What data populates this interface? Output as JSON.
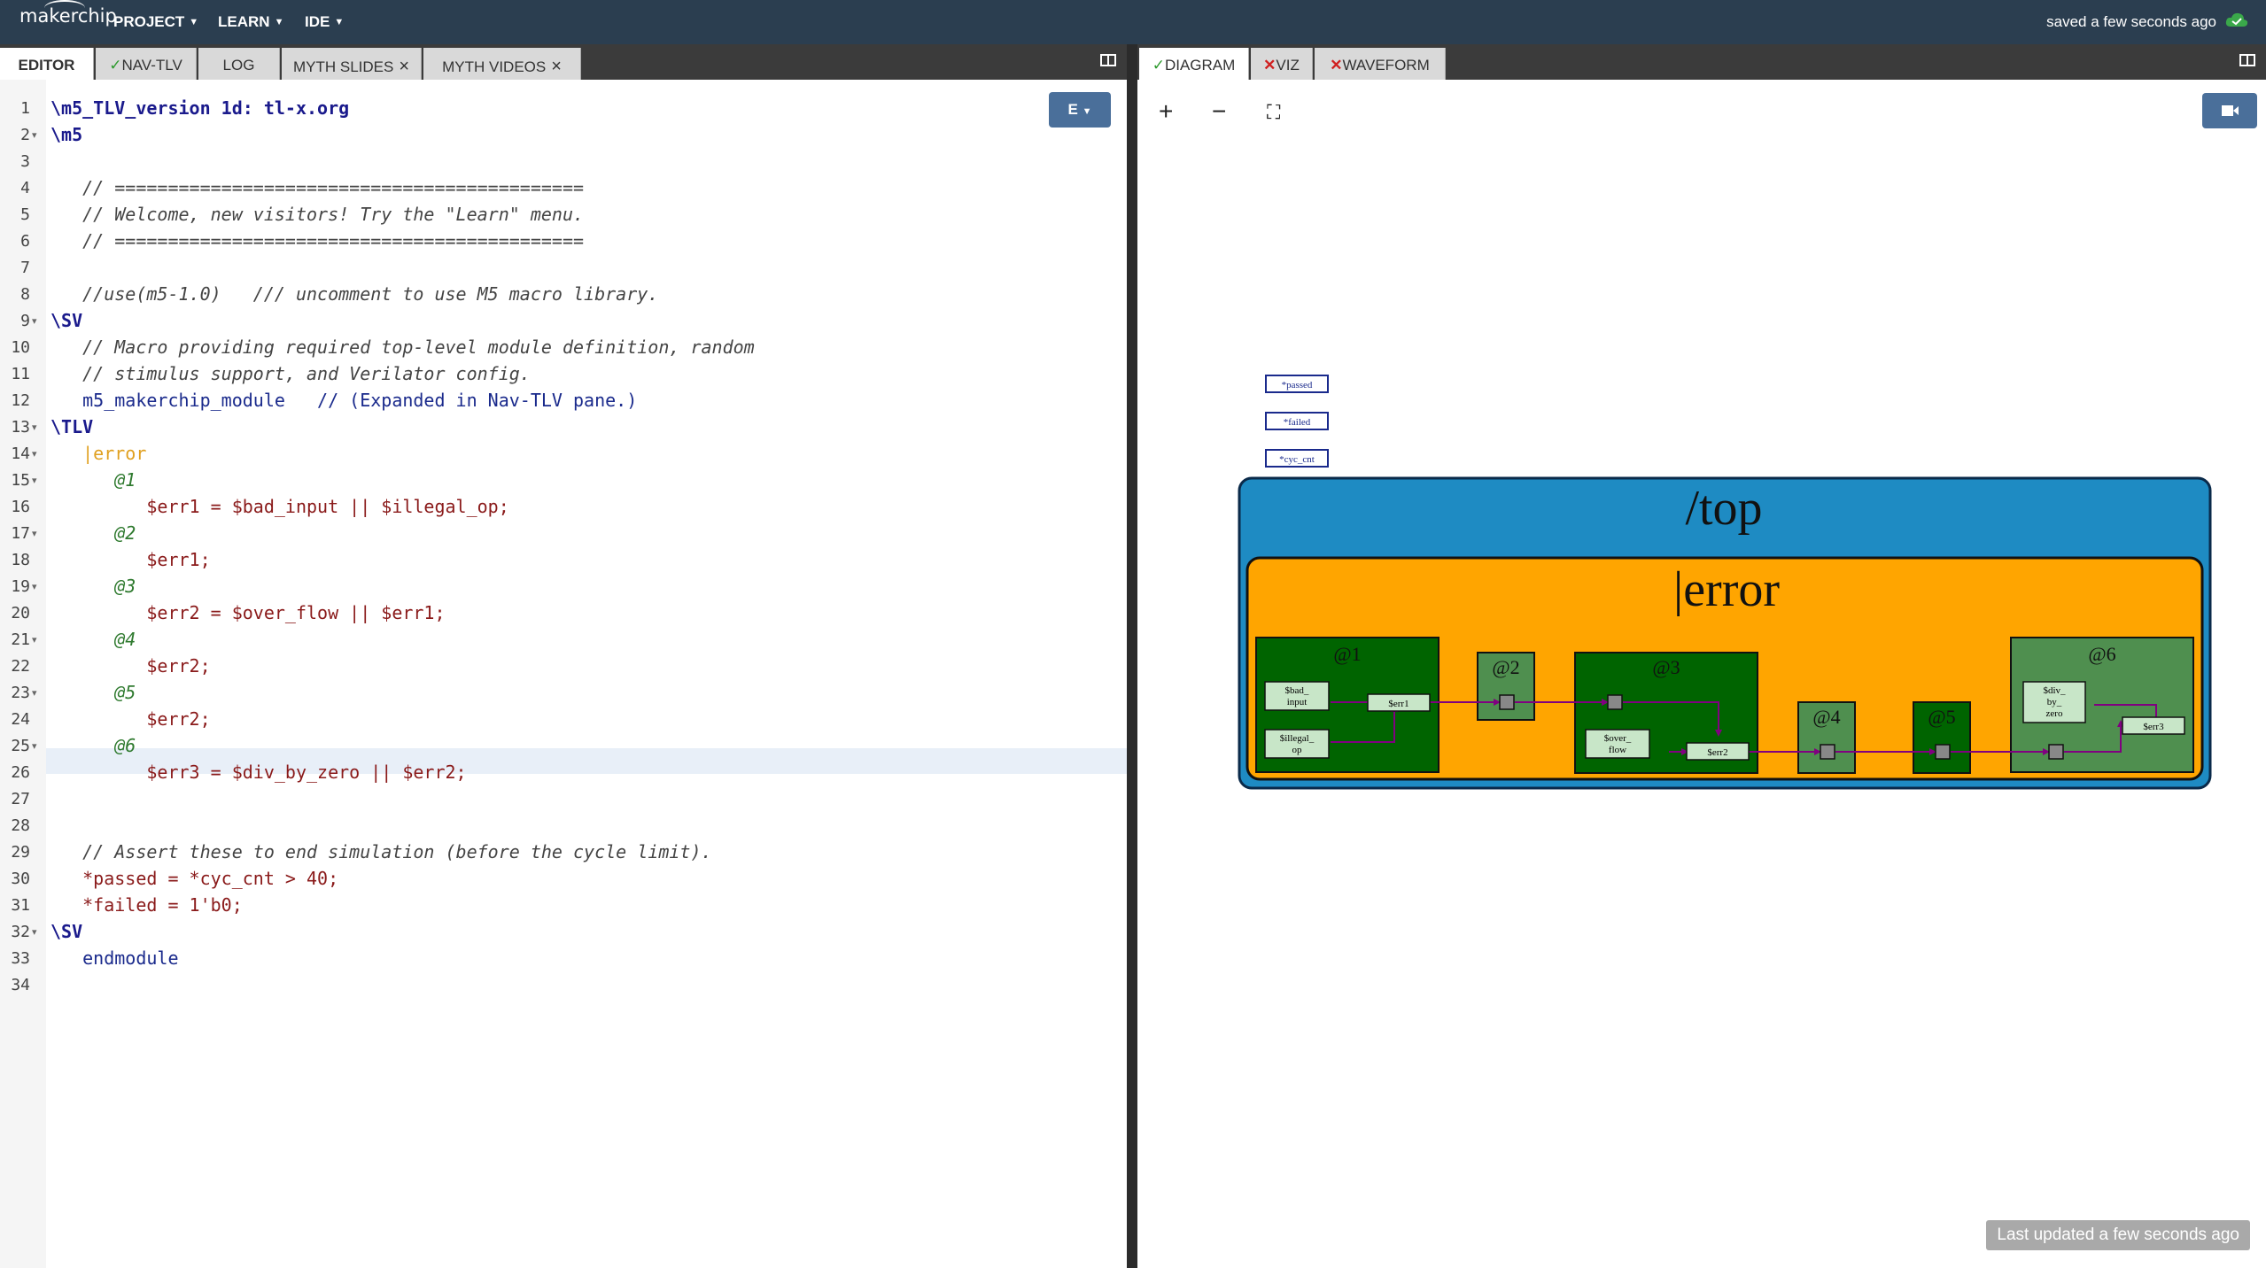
{
  "header": {
    "logo": "makerchip",
    "menus": [
      "PROJECT",
      "LEARN",
      "IDE"
    ],
    "status": "saved a few seconds ago"
  },
  "left_tabs": [
    {
      "label": "EDITOR",
      "active": true
    },
    {
      "label": "NAV-TLV",
      "status": "check"
    },
    {
      "label": "LOG"
    },
    {
      "label": "MYTH SLIDES",
      "closable": true
    },
    {
      "label": "MYTH VIDEOS",
      "closable": true
    }
  ],
  "right_tabs": [
    {
      "label": "DIAGRAM",
      "status": "check",
      "active": true
    },
    {
      "label": "VIZ",
      "status": "error"
    },
    {
      "label": "WAVEFORM",
      "status": "error"
    }
  ],
  "editor": {
    "mode_button": "E",
    "lines": [
      "\\m5_TLV_version 1d: tl-x.org",
      "\\m5",
      "",
      "   // ============================================",
      "   // Welcome, new visitors! Try the \"Learn\" menu.",
      "   // ============================================",
      "",
      "   //use(m5-1.0)   /// uncomment to use M5 macro library.",
      "\\SV",
      "   // Macro providing required top-level module definition, random",
      "   // stimulus support, and Verilator config.",
      "   m5_makerchip_module   // (Expanded in Nav-TLV pane.)",
      "\\TLV",
      "   |error",
      "      @1",
      "         $err1 = $bad_input || $illegal_op;",
      "      @2",
      "         $err1;",
      "      @3",
      "         $err2 = $over_flow || $err1;",
      "      @4",
      "         $err2;",
      "      @5",
      "         $err2;",
      "      @6",
      "         $err3 = $div_by_zero || $err2;",
      "",
      "",
      "   // Assert these to end simulation (before the cycle limit).",
      "   *passed = *cyc_cnt > 40;",
      "   *failed = 1'b0;",
      "\\SV",
      "   endmodule",
      ""
    ],
    "folds": [
      2,
      9,
      13,
      14,
      15,
      17,
      19,
      21,
      23,
      25,
      32
    ]
  },
  "diagram": {
    "zoom_in": "+",
    "zoom_out": "−",
    "fit": "⛶",
    "signals": [
      "*passed",
      "*failed",
      "*cyc_cnt"
    ],
    "scope_top": "/top",
    "scope_pipe": "|error",
    "stages": [
      "@1",
      "@2",
      "@3",
      "@4",
      "@5",
      "@6"
    ],
    "nodes": {
      "bad_input": [
        "$bad_",
        "input"
      ],
      "illegal_op": [
        "$illegal_",
        "op"
      ],
      "err1": "$err1",
      "over_flow": [
        "$over_",
        "flow"
      ],
      "err2": "$err2",
      "div_by_zero": [
        "$div_",
        "by_",
        "zero"
      ],
      "err3": "$err3"
    },
    "last_updated": "Last updated a few seconds ago"
  },
  "colors": {
    "topbar": "#2b3e50",
    "top_scope": "#1e8bc3",
    "pipe_scope": "#ffa500",
    "stage_dark": "#006400",
    "stage_light": "#4f8f4f",
    "wire": "#800080"
  }
}
